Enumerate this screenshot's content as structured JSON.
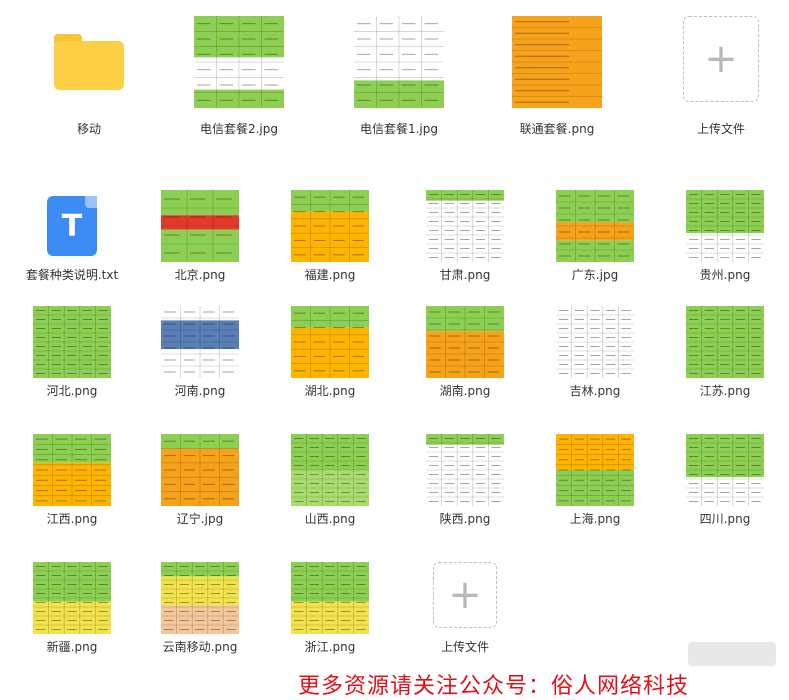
{
  "top_row": [
    {
      "name": "移动",
      "type": "folder"
    },
    {
      "name": "电信套餐2.jpg",
      "type": "image",
      "scheme": "green-table"
    },
    {
      "name": "电信套餐1.jpg",
      "type": "image",
      "scheme": "white-table"
    },
    {
      "name": "联通套餐.png",
      "type": "image",
      "scheme": "orange"
    },
    {
      "name": "上传文件",
      "type": "upload"
    }
  ],
  "files": [
    {
      "name": "套餐种类说明.txt",
      "type": "txt",
      "icon_letter": "T"
    },
    {
      "name": "北京.png",
      "scheme": "green-red"
    },
    {
      "name": "福建.png",
      "scheme": "green-orange"
    },
    {
      "name": "甘肃.png",
      "scheme": "white-green"
    },
    {
      "name": "广东.jpg",
      "scheme": "green-orange2"
    },
    {
      "name": "贵州.png",
      "scheme": "green-white"
    },
    {
      "name": "河北.png",
      "scheme": "green"
    },
    {
      "name": "河南.png",
      "scheme": "blue-screen"
    },
    {
      "name": "湖北.png",
      "scheme": "green-orange"
    },
    {
      "name": "湖南.png",
      "scheme": "green-orange3"
    },
    {
      "name": "吉林.png",
      "scheme": "white"
    },
    {
      "name": "江苏.png",
      "scheme": "green"
    },
    {
      "name": "江西.png",
      "scheme": "green-orange4"
    },
    {
      "name": "辽宁.jpg",
      "scheme": "orange-grid"
    },
    {
      "name": "山西.png",
      "scheme": "green-light"
    },
    {
      "name": "陕西.png",
      "scheme": "white-green"
    },
    {
      "name": "上海.png",
      "scheme": "orange-green"
    },
    {
      "name": "四川.png",
      "scheme": "green-white"
    },
    {
      "name": "新疆.png",
      "scheme": "green-yellow"
    },
    {
      "name": "云南移动.png",
      "scheme": "yellow-peach"
    },
    {
      "name": "浙江.png",
      "scheme": "green-yellow"
    },
    {
      "name": "上传文件",
      "type": "upload"
    }
  ],
  "promo_text": "更多资源请关注公众号：俗人网络科技",
  "colors": {
    "green": "#8ccf52",
    "orange": "#f7a21b",
    "red": "#e23a2a",
    "folder": "#fdcf44",
    "txt": "#3d8cf6",
    "promo": "#e0111a"
  }
}
